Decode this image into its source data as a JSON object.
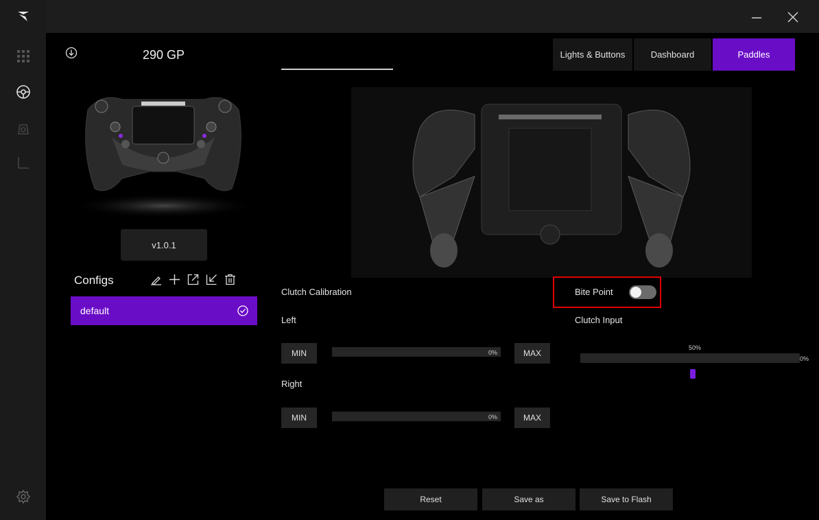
{
  "header": {
    "model_name": "290 GP",
    "version": "v1.0.1"
  },
  "tabs": [
    {
      "label": "Lights & Buttons"
    },
    {
      "label": "Dashboard"
    },
    {
      "label": "Paddles",
      "active": true
    }
  ],
  "configs": {
    "title": "Configs",
    "items": [
      {
        "label": "default",
        "selected": true
      }
    ]
  },
  "clutch": {
    "title": "Clutch Calibration",
    "left": {
      "label": "Left",
      "min_label": "MIN",
      "max_label": "MAX",
      "percent": "0%"
    },
    "right": {
      "label": "Right",
      "min_label": "MIN",
      "max_label": "MAX",
      "percent": "0%"
    }
  },
  "bite_point": {
    "label": "Bite Point",
    "enabled": false,
    "input_label": "Clutch Input",
    "marker_percent": "50%",
    "value_percent": "0%"
  },
  "actions": {
    "reset": "Reset",
    "save_as": "Save as",
    "save_flash": "Save to Flash"
  },
  "colors": {
    "accent": "#6a0dc7",
    "highlight": "#e00000"
  }
}
